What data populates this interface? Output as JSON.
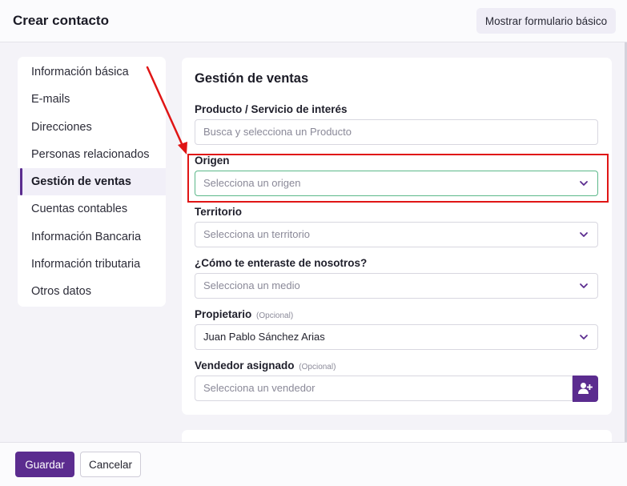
{
  "header": {
    "title": "Crear contacto",
    "basic_form_button": "Mostrar formulario básico"
  },
  "sidebar": {
    "items": [
      {
        "label": "Información básica"
      },
      {
        "label": "E-mails"
      },
      {
        "label": "Direcciones"
      },
      {
        "label": "Personas relacionados"
      },
      {
        "label": "Gestión de ventas",
        "active": true
      },
      {
        "label": "Cuentas contables"
      },
      {
        "label": "Información Bancaria"
      },
      {
        "label": "Información tributaria"
      },
      {
        "label": "Otros datos"
      }
    ]
  },
  "section": {
    "title": "Gestión de ventas",
    "fields": {
      "product": {
        "label": "Producto / Servicio de interés",
        "placeholder": "Busca y selecciona un Producto"
      },
      "origin": {
        "label": "Origen",
        "placeholder": "Selecciona un origen"
      },
      "territory": {
        "label": "Territorio",
        "placeholder": "Selecciona un territorio"
      },
      "source": {
        "label": "¿Cómo te enteraste de nosotros?",
        "placeholder": "Selecciona un medio"
      },
      "owner": {
        "label": "Propietario",
        "optional": "(Opcional)",
        "value": "Juan Pablo Sánchez Arias"
      },
      "seller": {
        "label": "Vendedor asignado",
        "optional": "(Opcional)",
        "placeholder": "Selecciona un vendedor"
      }
    }
  },
  "footer": {
    "save": "Guardar",
    "cancel": "Cancelar"
  },
  "icons": {
    "chevron": "chevron-down-icon",
    "add_user": "user-plus-icon"
  },
  "colors": {
    "accent": "#5b2c8f",
    "annotation": "#e01515",
    "focus": "#5cb88a"
  }
}
